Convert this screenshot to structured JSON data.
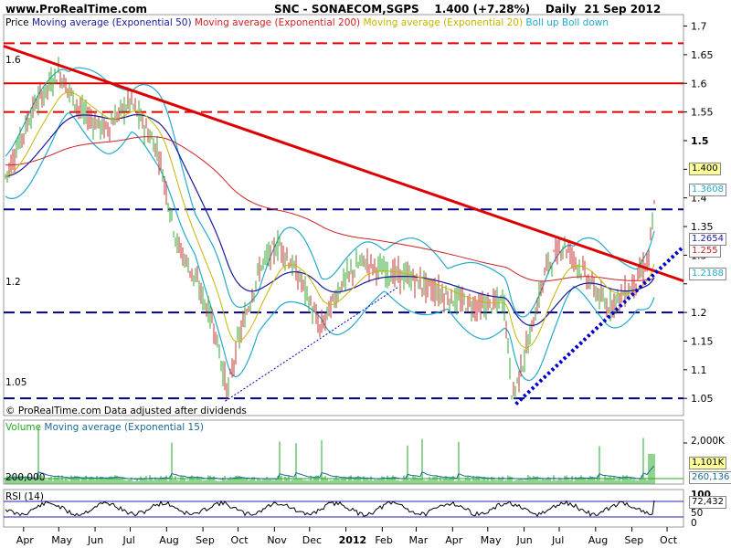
{
  "header": {
    "site": "www.ProRealTime.com",
    "instrument": "SNC - SONAECOM,SGPS",
    "last": "1.400 (+7.28%)",
    "period": "Daily",
    "date": "21 Sep 2012"
  },
  "price_panel": {
    "legend": [
      {
        "text": "Price",
        "color": "#000000"
      },
      {
        "text": "Moving average (Exponential 50)",
        "color": "#1a1a9a"
      },
      {
        "text": "Moving average (Exponential 200)",
        "color": "#cc2222"
      },
      {
        "text": "Moving average (Exponential 20)",
        "color": "#c8b400"
      },
      {
        "text": "Boll up Boll down",
        "color": "#22aacc"
      }
    ],
    "footer": "© ProRealTime.com  Data adjusted after dividends",
    "left_labels": [
      "1.6",
      "1.2",
      "1.05"
    ],
    "right_tags": [
      {
        "text": "1.400",
        "color": "#000000",
        "bg": "#ffff99"
      },
      {
        "text": "1.3608",
        "color": "#22aacc",
        "bg": "#ffffff"
      },
      {
        "text": "1.2654",
        "color": "#1a1a9a",
        "bg": "#ffffff"
      },
      {
        "text": "1.255",
        "color": "#cc2222",
        "bg": "#ffffff"
      },
      {
        "text": "1.2188",
        "color": "#22aacc",
        "bg": "#ffffff"
      }
    ]
  },
  "volume_panel": {
    "legend": [
      {
        "text": "Volume",
        "color": "#22aa22"
      },
      {
        "text": "Moving average (Exponential 15)",
        "color": "#1a6a9a"
      }
    ],
    "left_label": "200,000",
    "right_labels": [
      "2,000K"
    ],
    "right_tags": [
      {
        "text": "1,101K",
        "color": "#000000",
        "bg": "#ffff99"
      },
      {
        "text": "260,136",
        "color": "#1a6a9a",
        "bg": "#ffffff"
      }
    ]
  },
  "rsi_panel": {
    "legend": "RSI (14)",
    "right_labels": [
      "100",
      "50",
      "0"
    ],
    "right_tag": {
      "text": "72,432",
      "color": "#000000",
      "bg": "#ffffff"
    }
  },
  "chart_data": {
    "type": "candlestick",
    "x_axis_labels": [
      "Apr",
      "May",
      "Jun",
      "Jul",
      "Aug",
      "Sep",
      "Oct",
      "Nov",
      "Dec",
      "2012",
      "Feb",
      "Mar",
      "Apr",
      "May",
      "Jun",
      "Jul",
      "Aug",
      "Sep",
      "Oct"
    ],
    "y_axis": {
      "ticks": [
        1.05,
        1.1,
        1.15,
        1.2,
        1.25,
        1.3,
        1.35,
        1.4,
        1.45,
        1.5,
        1.55,
        1.6,
        1.65,
        1.7
      ],
      "tick_labels": [
        "1.05",
        "1.1",
        "1.15",
        "1.2",
        "",
        "1.3",
        "1.35",
        "1.4",
        "1.45",
        "1.5",
        "1.55",
        "1.6",
        "1.65",
        "1.7"
      ],
      "range": [
        1.02,
        1.72
      ]
    },
    "horizontal_levels": [
      {
        "value": 1.67,
        "color": "#dd0000",
        "style": "dashed"
      },
      {
        "value": 1.6,
        "color": "#dd0000",
        "style": "solid"
      },
      {
        "value": 1.55,
        "color": "#dd0000",
        "style": "dashed"
      },
      {
        "value": 1.38,
        "color": "#000088",
        "style": "dashed"
      },
      {
        "value": 1.2,
        "color": "#000088",
        "style": "dashed"
      },
      {
        "value": 1.05,
        "color": "#000088",
        "style": "dashed"
      }
    ],
    "trendlines": [
      {
        "x": [
          "2011-03-15",
          "2012-10-15"
        ],
        "y": [
          1.665,
          1.255
        ],
        "color": "#dd0000",
        "style": "solid"
      },
      {
        "x": [
          "2011-09-20",
          "2012-02-15"
        ],
        "y": [
          1.045,
          1.245
        ],
        "color": "#0000cc",
        "style": "dotted"
      },
      {
        "x": [
          "2012-05-25",
          "2012-10-15"
        ],
        "y": [
          1.04,
          1.315
        ],
        "color": "#0000cc",
        "style": "dotted-thick"
      }
    ],
    "close_path": [
      [
        "2011-03-15",
        1.43
      ],
      [
        "2011-04-10",
        1.56
      ],
      [
        "2011-05-01",
        1.62
      ],
      [
        "2011-05-20",
        1.55
      ],
      [
        "2011-06-10",
        1.52
      ],
      [
        "2011-07-01",
        1.57
      ],
      [
        "2011-07-25",
        1.48
      ],
      [
        "2011-08-10",
        1.32
      ],
      [
        "2011-08-25",
        1.26
      ],
      [
        "2011-09-10",
        1.18
      ],
      [
        "2011-09-22",
        1.06
      ],
      [
        "2011-10-01",
        1.15
      ],
      [
        "2011-10-20",
        1.28
      ],
      [
        "2011-11-05",
        1.32
      ],
      [
        "2011-11-25",
        1.25
      ],
      [
        "2011-12-10",
        1.17
      ],
      [
        "2011-12-28",
        1.25
      ],
      [
        "2012-01-15",
        1.29
      ],
      [
        "2012-02-05",
        1.27
      ],
      [
        "2012-02-25",
        1.26
      ],
      [
        "2012-03-15",
        1.24
      ],
      [
        "2012-04-05",
        1.22
      ],
      [
        "2012-04-25",
        1.21
      ],
      [
        "2012-05-15",
        1.22
      ],
      [
        "2012-05-22",
        1.05
      ],
      [
        "2012-06-05",
        1.15
      ],
      [
        "2012-06-20",
        1.28
      ],
      [
        "2012-07-05",
        1.32
      ],
      [
        "2012-07-25",
        1.26
      ],
      [
        "2012-08-10",
        1.21
      ],
      [
        "2012-08-30",
        1.24
      ],
      [
        "2012-09-15",
        1.29
      ],
      [
        "2012-09-21",
        1.4
      ]
    ],
    "last_close": 1.4
  }
}
